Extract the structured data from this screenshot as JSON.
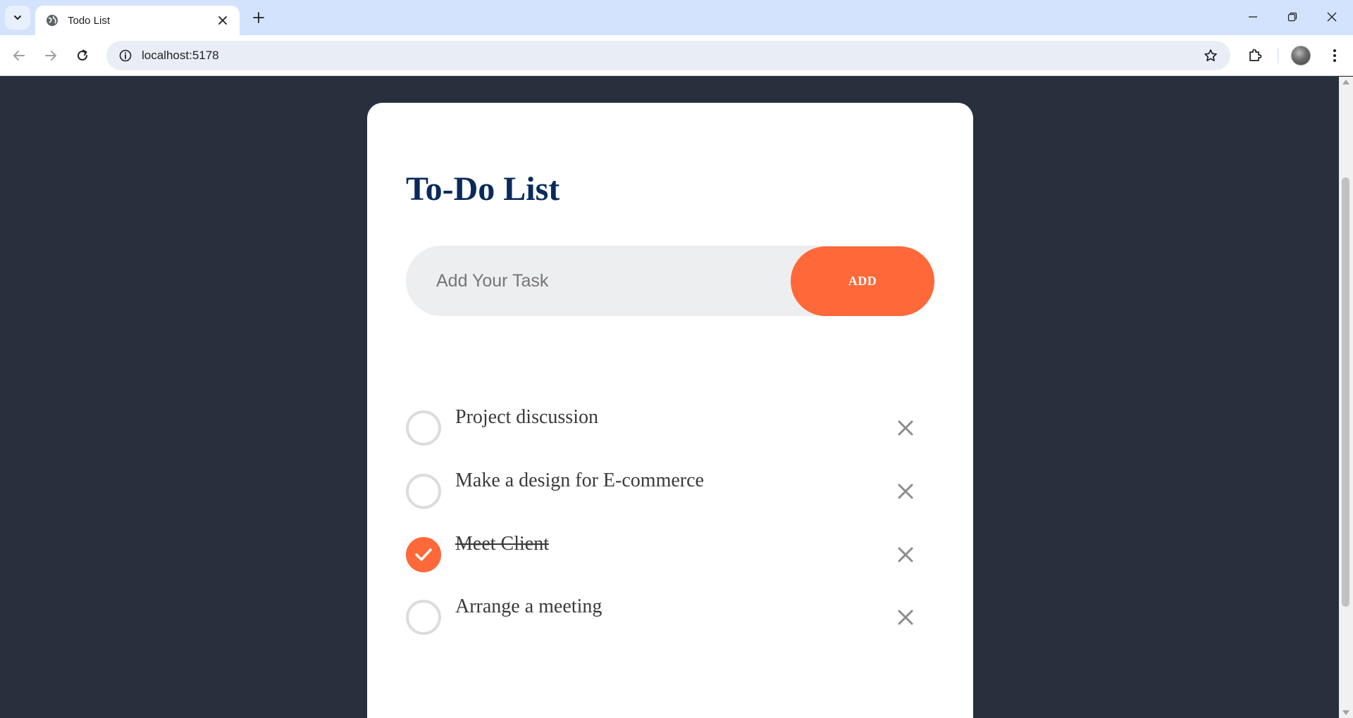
{
  "browser": {
    "tab_title": "Todo List",
    "url": "localhost:5178"
  },
  "app": {
    "title": "To-Do List",
    "input_placeholder": "Add Your Task",
    "add_label": "ADD",
    "accent_color": "#ff6838",
    "title_color": "#0a2a5e",
    "page_background": "#282f3d",
    "tasks": [
      {
        "text": "Project discussion",
        "done": false
      },
      {
        "text": "Make a design for E-commerce",
        "done": false
      },
      {
        "text": "Meet Client",
        "done": true
      },
      {
        "text": "Arrange a meeting",
        "done": false
      }
    ]
  }
}
